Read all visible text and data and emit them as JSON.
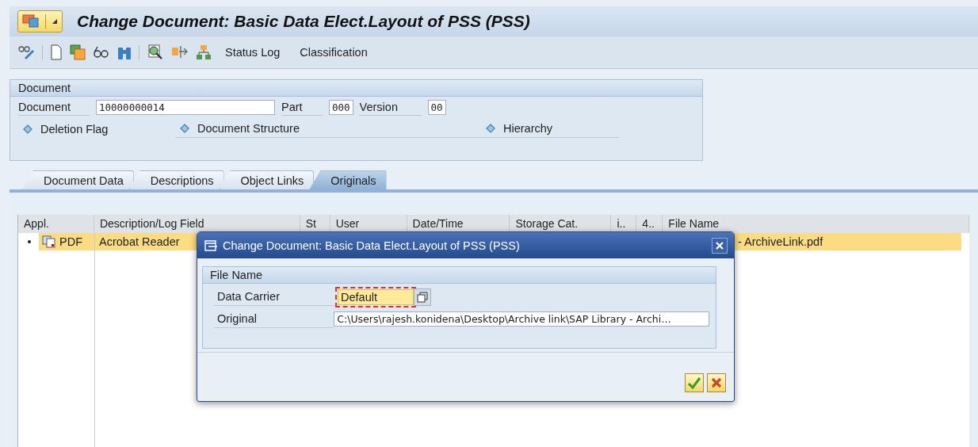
{
  "window": {
    "title": "Change Document: Basic Data Elect.Layout of PSS (PSS)"
  },
  "toolbar": {
    "buttons": [
      "Status Log",
      "Classification"
    ]
  },
  "document_group": {
    "title": "Document",
    "document_label": "Document",
    "document_value": "10000000014",
    "part_label": "Part",
    "part_value": "000",
    "version_label": "Version",
    "version_value": "00",
    "links": [
      "Deletion Flag",
      "Document Structure",
      "Hierarchy"
    ]
  },
  "tabs": [
    {
      "label": "Document Data",
      "selected": false
    },
    {
      "label": "Descriptions",
      "selected": false
    },
    {
      "label": "Object Links",
      "selected": false
    },
    {
      "label": "Originals",
      "selected": true
    }
  ],
  "table": {
    "columns": [
      "Appl.",
      "Description/Log Field",
      "St",
      "User",
      "Date/Time",
      "Storage Cat.",
      "i..",
      "4..",
      "File Name"
    ],
    "rows": [
      {
        "selected": true,
        "application": "PDF",
        "description": "Acrobat Reader",
        "file_name": "- ArchiveLink.pdf"
      }
    ]
  },
  "dialog": {
    "title": "Change Document: Basic Data Elect.Layout of PSS (PSS)",
    "group_title": "File Name",
    "data_carrier_label": "Data Carrier",
    "data_carrier_value": "Default",
    "original_label": "Original",
    "original_value": "C:\\Users\\rajesh.konidena\\Desktop\\Archive link\\SAP Library - Archi…"
  }
}
